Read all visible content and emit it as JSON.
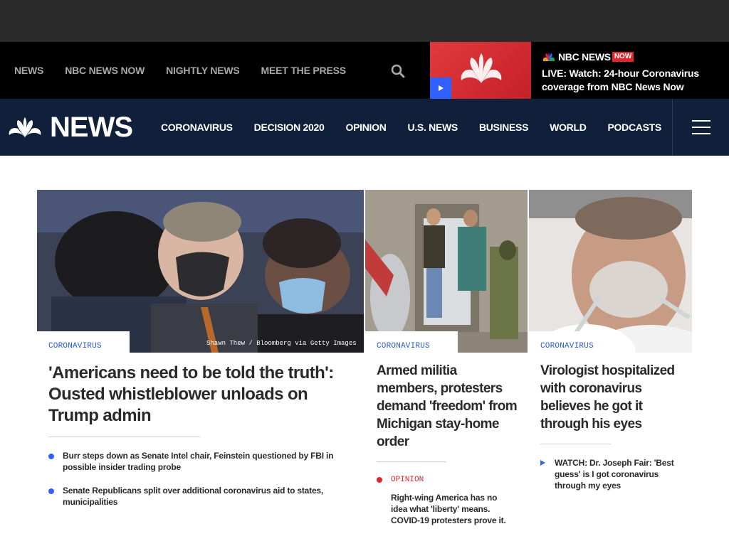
{
  "top_nav": {
    "links": [
      "NEWS",
      "NBC NEWS NOW",
      "NIGHTLY NEWS",
      "MEET THE PRESS"
    ]
  },
  "live": {
    "logo_word": "NBC NEWS",
    "logo_badge": "NOW",
    "text": "LIVE: Watch: 24-hour Coronavirus coverage from NBC News Now"
  },
  "main_nav": {
    "logo_word": "NEWS",
    "links": [
      "CORONAVIRUS",
      "DECISION 2020",
      "OPINION",
      "U.S. NEWS",
      "BUSINESS",
      "WORLD",
      "PODCASTS"
    ]
  },
  "stories": [
    {
      "label": "CORONAVIRUS",
      "credit": "Shawn Thew / Bloomberg via Getty Images",
      "headline": "'Americans need to be told the truth': Ousted whistleblower unloads on Trump admin",
      "related": [
        "Burr steps down as Senate Intel chair, Feinstein questioned by FBI in possible insider trading probe",
        "Senate Republicans split over additional coronavirus aid to states, municipalities"
      ]
    },
    {
      "label": "CORONAVIRUS",
      "headline": "Armed militia members, protesters demand 'freedom' from Michigan stay-home order",
      "related_label": "OPINION",
      "related": [
        "Right-wing America has no idea what 'liberty' means. COVID-19 protesters prove it."
      ]
    },
    {
      "label": "CORONAVIRUS",
      "headline": "Virologist hospitalized with coronavirus believes he got it through his eyes",
      "related": [
        "WATCH: Dr. Joseph Fair: 'Best guess' is I got coronavirus through my eyes"
      ]
    }
  ],
  "colors": {
    "nav_bg": "#10203b",
    "accent_blue": "#3061ff",
    "accent_red": "#e3262d",
    "label_blue": "#2a5bd7"
  },
  "icons": {
    "search": "search-icon",
    "menu": "hamburger-menu-icon",
    "play": "play-icon",
    "peacock": "peacock-logo-icon"
  }
}
